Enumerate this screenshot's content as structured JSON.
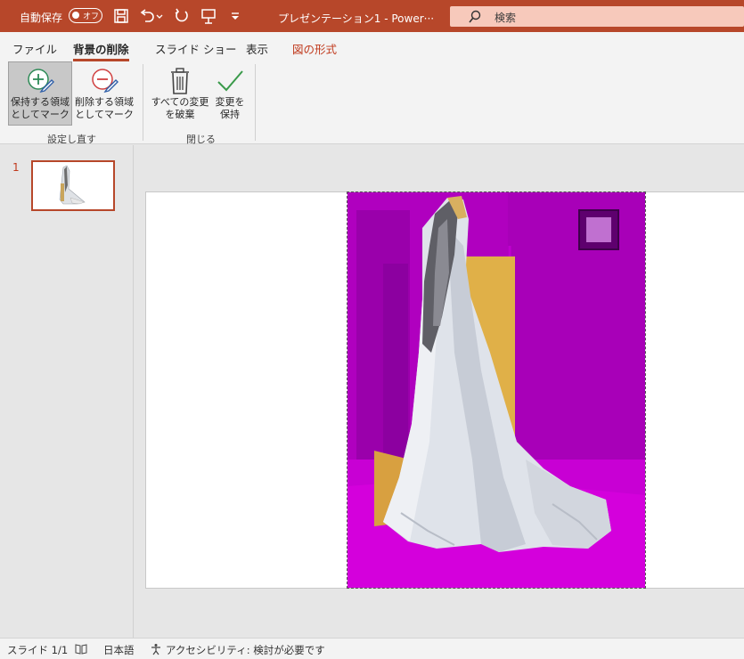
{
  "titlebar": {
    "autosave_label": "自動保存",
    "autosave_state": "オフ",
    "doc_title": "プレゼンテーション1  -  Power···",
    "search_placeholder": "検索"
  },
  "ribbon": {
    "tabs": [
      {
        "label": "ファイル"
      },
      {
        "label": "背景の削除"
      },
      {
        "label": "スライド ショー"
      },
      {
        "label": "表示"
      },
      {
        "label": "図の形式"
      }
    ],
    "buttons": {
      "mark_keep": "保持する領域としてマーク",
      "mark_keep_l1": "保持する領域",
      "mark_keep_l2": "としてマーク",
      "mark_remove_l1": "削除する領域",
      "mark_remove_l2": "としてマーク",
      "discard_l1": "すべての変更",
      "discard_l2": "を破棄",
      "keep_l1": "変更を",
      "keep_l2": "保持"
    },
    "groups": {
      "refine": "設定し直す",
      "close": "閉じる"
    }
  },
  "slides_pane": {
    "slide_number": "1"
  },
  "statusbar": {
    "slide_info": "スライド 1/1",
    "language": "日本語",
    "accessibility": "アクセシビリティ: 検討が必要です"
  },
  "colors": {
    "accent": "#b7472a",
    "removal_overlay": "#b000c0"
  },
  "icons": [
    "save-icon",
    "undo-icon",
    "redo-icon",
    "present-icon",
    "customize-icon",
    "search-icon",
    "mark-keep-icon",
    "mark-remove-icon",
    "trash-icon",
    "check-icon",
    "book-icon",
    "accessibility-icon"
  ]
}
